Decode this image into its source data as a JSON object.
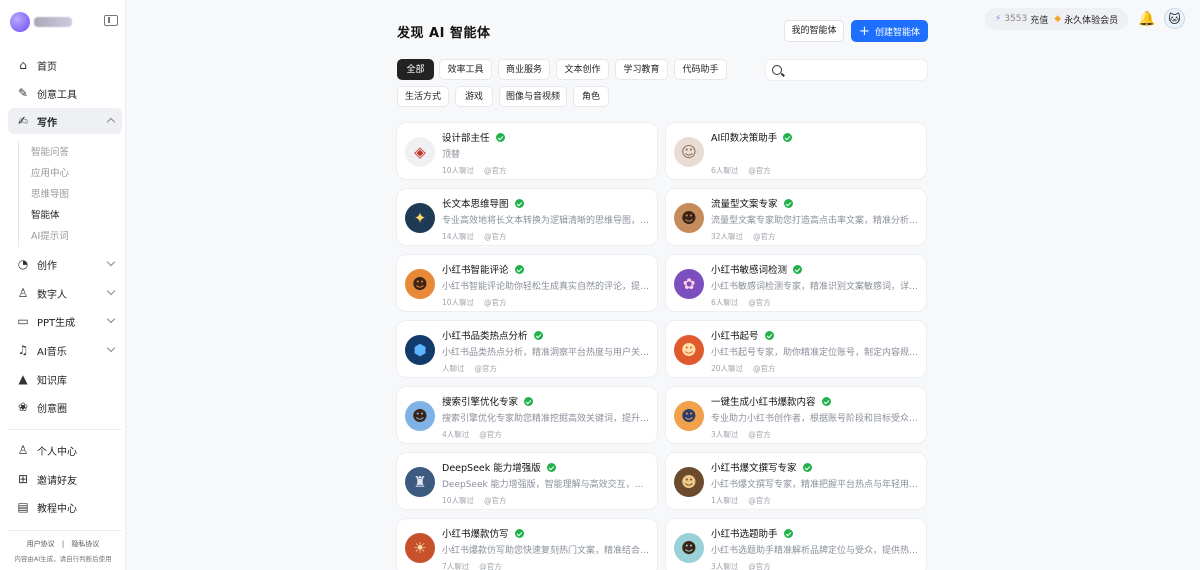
{
  "topbar": {
    "credits_number": "3553",
    "recharge_label": "充值",
    "membership_label": "永久体验会员"
  },
  "sidebar": {
    "items": [
      {
        "label": "首页",
        "icon": "home-icon",
        "glyph": "⌂"
      },
      {
        "label": "创意工具",
        "icon": "creative-tools-icon",
        "glyph": "✎"
      },
      {
        "label": "写作",
        "icon": "writing-icon",
        "glyph": "✍"
      },
      {
        "label": "创作",
        "icon": "create-icon",
        "glyph": "◔"
      },
      {
        "label": "数字人",
        "icon": "digital-human-icon",
        "glyph": "♙"
      },
      {
        "label": "PPT生成",
        "icon": "ppt-icon",
        "glyph": "▭"
      },
      {
        "label": "AI音乐",
        "icon": "music-icon",
        "glyph": "♫"
      },
      {
        "label": "知识库",
        "icon": "knowledge-base-icon",
        "glyph": "🎓"
      },
      {
        "label": "创意圈",
        "icon": "creative-circle-icon",
        "glyph": "❀"
      },
      {
        "label": "个人中心",
        "icon": "user-icon",
        "glyph": "♙"
      },
      {
        "label": "邀请好友",
        "icon": "invite-icon",
        "glyph": "⊞"
      },
      {
        "label": "教程中心",
        "icon": "tutorial-icon",
        "glyph": "📖"
      }
    ],
    "writing_subitems": [
      "智能问答",
      "应用中心",
      "思维导图",
      "智能体",
      "AI提示词"
    ],
    "legal": {
      "user_agreement": "用户协议",
      "separator": "|",
      "privacy_policy": "隐私协议",
      "disclaimer": "内容由AI生成，请自行判断后使用"
    }
  },
  "main": {
    "title": "发现 AI 智能体",
    "my_agents_label": "我的智能体",
    "create_label": "创建智能体",
    "search_placeholder": "",
    "filters": [
      "全部",
      "效率工具",
      "商业服务",
      "文本创作",
      "学习教育",
      "代码助手",
      "生活方式",
      "游戏",
      "图像与音视频",
      "角色"
    ],
    "active_filter": "全部",
    "cards": [
      {
        "name": "设计部主任",
        "desc": "顶替",
        "uses": "10人聊过",
        "author": "@官方",
        "icon": "◈",
        "bg": "#f1f1f4",
        "color": "#c0392b"
      },
      {
        "name": "AI印数决策助手",
        "desc": "",
        "uses": "6人聊过",
        "author": "@官方",
        "icon": "☺",
        "bg": "#e9dcd4",
        "color": "#8a6a55"
      },
      {
        "name": "长文本思维导图",
        "desc": "专业高效地将长文本转换为逻辑清晰的思维导图，精准提炼核心内容",
        "uses": "14人聊过",
        "author": "@官方",
        "icon": "✦",
        "bg": "#1e3a55",
        "color": "#ffd86b"
      },
      {
        "name": "流量型文案专家",
        "desc": "流量型文案专家助您打造高点击率文案，精准分析用户心理与热点",
        "uses": "32人聊过",
        "author": "@官方",
        "icon": "☻",
        "bg": "#c58b5a",
        "color": "#3b2416"
      },
      {
        "name": "小红书智能评论",
        "desc": "小红书智能评论助你轻松生成真实自然的评论，提升互动与曝光",
        "uses": "10人聊过",
        "author": "@官方",
        "icon": "☻",
        "bg": "#e8893a",
        "color": "#3b2416"
      },
      {
        "name": "小红书敏感词检测",
        "desc": "小红书敏感词检测专家，精准识别文案敏感词，详解违规原因",
        "uses": "6人聊过",
        "author": "@官方",
        "icon": "✿",
        "bg": "#7c4fbf",
        "color": "#ffd1e6"
      },
      {
        "name": "小红书品类热点分析",
        "desc": "小红书品类热点分析，精准洞察平台热度与用户关注趋势",
        "uses": "人聊过",
        "author": "@官方",
        "icon": "⬢",
        "bg": "#123a6b",
        "color": "#5fb4ff"
      },
      {
        "name": "小红书起号",
        "desc": "小红书起号专家，助你精准定位账号，制定内容规划与增长策略",
        "uses": "20人聊过",
        "author": "@官方",
        "icon": "☻",
        "bg": "#e05a2e",
        "color": "#ffe0a8"
      },
      {
        "name": "搜索引擎优化专家",
        "desc": "搜索引擎优化专家助您精准挖掘高效关键词，提升网站排名",
        "uses": "4人聊过",
        "author": "@官方",
        "icon": "☻",
        "bg": "#7fb2e5",
        "color": "#3b2416"
      },
      {
        "name": "一键生成小红书爆款内容",
        "desc": "专业助力小红书创作者，根据账号阶段和目标受众，生成爆款内容",
        "uses": "3人聊过",
        "author": "@官方",
        "icon": "☻",
        "bg": "#f0a14a",
        "color": "#2d3d6b"
      },
      {
        "name": "DeepSeek 能力增强版",
        "desc": "DeepSeek 能力增强版，智能理解与高效交互，助您解决复杂问题",
        "uses": "10人聊过",
        "author": "@官方",
        "icon": "♜",
        "bg": "#3d5a80",
        "color": "#e0e6f0"
      },
      {
        "name": "小红书爆文撰写专家",
        "desc": "小红书爆文撰写专家，精准把握平台热点与年轻用户喜好",
        "uses": "1人聊过",
        "author": "@官方",
        "icon": "☻",
        "bg": "#6b4a2e",
        "color": "#f0c98a"
      },
      {
        "name": "小红书爆款仿写",
        "desc": "小红书爆款仿写助您快速复刻热门文案，精准结合目标风格",
        "uses": "7人聊过",
        "author": "@官方",
        "icon": "☀",
        "bg": "#c8502a",
        "color": "#ffe6b0"
      },
      {
        "name": "小红书选题助手",
        "desc": "小红书选题助手精准解析品牌定位与受众，提供热门选题建议",
        "uses": "3人聊过",
        "author": "@官方",
        "icon": "☻",
        "bg": "#9ad0d8",
        "color": "#3b2416"
      }
    ]
  },
  "colors": {
    "primary": "#1f6fff",
    "active_chip": "#222222",
    "verified": "#22b14c",
    "background": "#f7f8fa"
  }
}
